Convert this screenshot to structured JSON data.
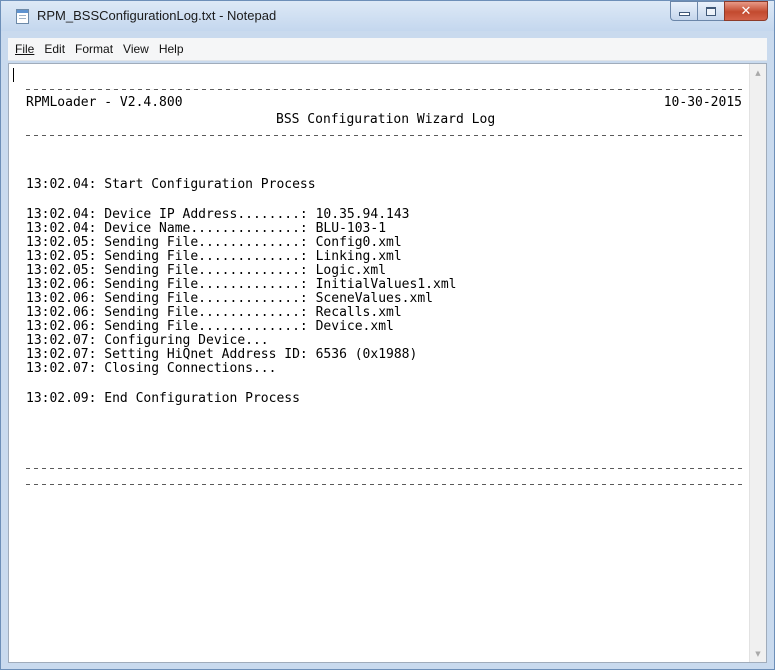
{
  "window": {
    "title": "RPM_BSSConfigurationLog.txt - Notepad",
    "minimize_icon": "minimize-icon",
    "maximize_icon": "maximize-icon",
    "close_icon": "close-icon"
  },
  "menu": {
    "file": "File",
    "edit": "Edit",
    "format": "Format",
    "view": "View",
    "help": "Help"
  },
  "log": {
    "program": "RPMLoader - V2.4.800",
    "title": "BSS Configuration Wizard Log",
    "date": "10-30-2015",
    "start": "13:02.04: Start Configuration Process",
    "lines": [
      "13:02.04: Device IP Address........: 10.35.94.143",
      "13:02.04: Device Name..............: BLU-103-1",
      "13:02.05: Sending File.............: Config0.xml",
      "13:02.05: Sending File.............: Linking.xml",
      "13:02.05: Sending File.............: Logic.xml",
      "13:02.06: Sending File.............: InitialValues1.xml",
      "13:02.06: Sending File.............: SceneValues.xml",
      "13:02.06: Sending File.............: Recalls.xml",
      "13:02.06: Sending File.............: Device.xml",
      "13:02.07: Configuring Device...",
      "13:02.07: Setting HiQnet Address ID: 6536 (0x1988)",
      "13:02.07: Closing Connections..."
    ],
    "end": "13:02.09: End Configuration Process"
  }
}
